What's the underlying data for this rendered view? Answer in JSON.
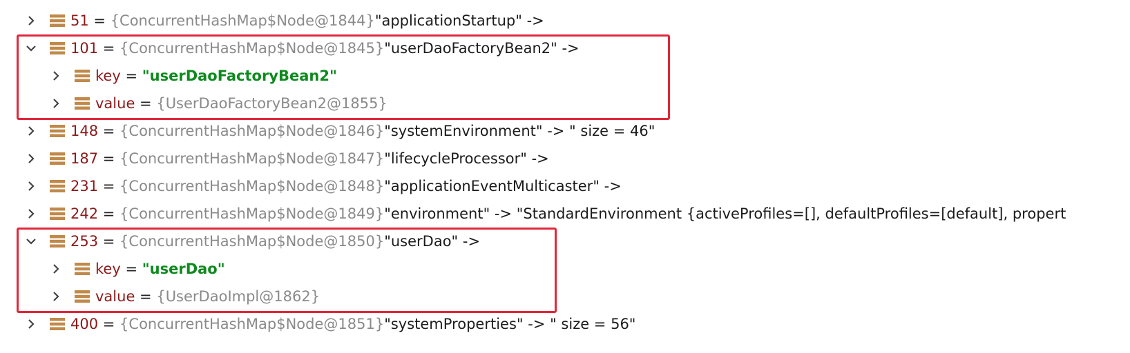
{
  "rows": [
    {
      "key": "51",
      "ref": "{ConcurrentHashMap$Node@1844}",
      "value": " \"applicationStartup\" ->"
    },
    {
      "key": "101",
      "ref": "{ConcurrentHashMap$Node@1845}",
      "value": " \"userDaoFactoryBean2\" ->",
      "children": [
        {
          "key": "key",
          "val": "\"userDaoFactoryBean2\""
        },
        {
          "key": "value",
          "ref": "{UserDaoFactoryBean2@1855}"
        }
      ]
    },
    {
      "key": "148",
      "ref": "{ConcurrentHashMap$Node@1846}",
      "value": " \"systemEnvironment\" -> \" size = 46\""
    },
    {
      "key": "187",
      "ref": "{ConcurrentHashMap$Node@1847}",
      "value": " \"lifecycleProcessor\" ->"
    },
    {
      "key": "231",
      "ref": "{ConcurrentHashMap$Node@1848}",
      "value": " \"applicationEventMulticaster\" ->"
    },
    {
      "key": "242",
      "ref": "{ConcurrentHashMap$Node@1849}",
      "value": " \"environment\" -> \"StandardEnvironment {activeProfiles=[], defaultProfiles=[default], propert"
    },
    {
      "key": "253",
      "ref": "{ConcurrentHashMap$Node@1850}",
      "value": " \"userDao\" ->",
      "children": [
        {
          "key": "key",
          "val": "\"userDao\""
        },
        {
          "key": "value",
          "ref": "{UserDaoImpl@1862}"
        }
      ]
    },
    {
      "key": "400",
      "ref": "{ConcurrentHashMap$Node@1851}",
      "value": " \"systemProperties\" -> \" size = 56\""
    }
  ],
  "colors": {
    "highlight": "#e0273a",
    "key": "#8b1a1a",
    "ref": "#8a8a8a",
    "string": "#0d8a1e",
    "icon": "#c0894a"
  },
  "icons": {
    "collapsed": "chevron-right-icon",
    "expanded": "chevron-down-icon",
    "node": "field-stack-icon"
  }
}
